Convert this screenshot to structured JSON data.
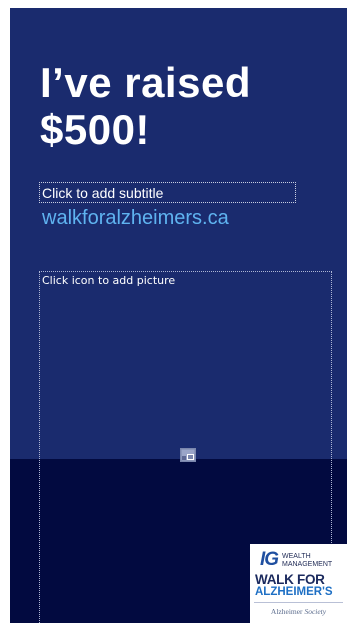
{
  "slide": {
    "headline": "I’ve raised $500!",
    "subtitle_placeholder": "Click to add subtitle",
    "website": "walkforalzheimers.ca",
    "picture_placeholder": "Click icon to add picture",
    "picture_icon": "insert-picture-icon"
  },
  "logo": {
    "brand": "IG",
    "brand_sub": "WEALTH\nMANAGEMENT",
    "walk": "WALK FOR",
    "alzheimers": "ALZHEIMER'S",
    "society_name": "Alzheimer",
    "society_word": "Society"
  },
  "colors": {
    "slide_background": "#1a2b6e",
    "bottom_band": "#020a40",
    "website_text": "#5fb3f0",
    "headline_text": "#ffffff"
  }
}
